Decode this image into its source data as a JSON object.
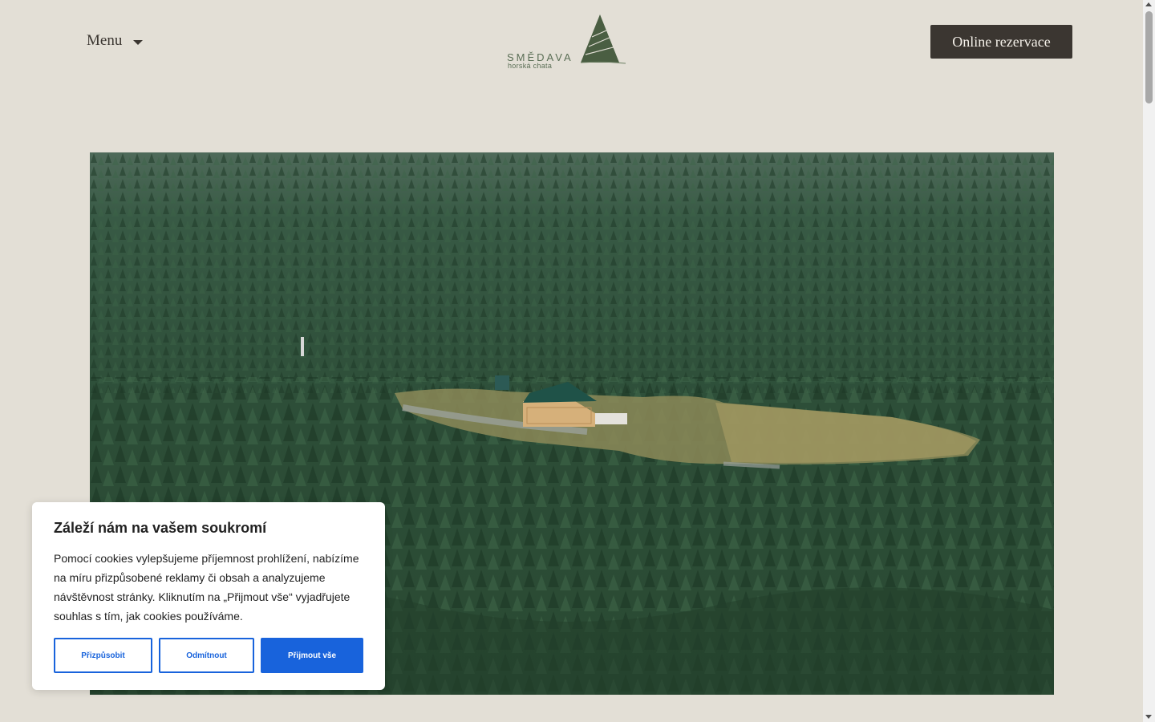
{
  "header": {
    "menu_label": "Menu",
    "reserve_label": "Online rezervace"
  },
  "logo": {
    "name": "SMĚDAVA",
    "subtitle": "horská chata"
  },
  "hero": {
    "image_description_icon": "aerial-forest-photo"
  },
  "cookie_banner": {
    "title": "Záleží nám na vašem soukromí",
    "text": "Pomocí cookies vylepšujeme příjemnost prohlížení, nabízíme na míru přizpůsobené reklamy či obsah a analyzujeme návštěvnost stránky. Kliknutím na „Přijmout vše“ vyjadřujete souhlas s tím, jak cookies používáme.",
    "customize_label": "Přizpůsobit",
    "reject_label": "Odmítnout",
    "accept_label": "Přijmout vše"
  },
  "colors": {
    "background": "#e3dfd6",
    "button_dark": "#3b3631",
    "accent_blue": "#1863dc",
    "logo_green": "#4a5e42"
  }
}
